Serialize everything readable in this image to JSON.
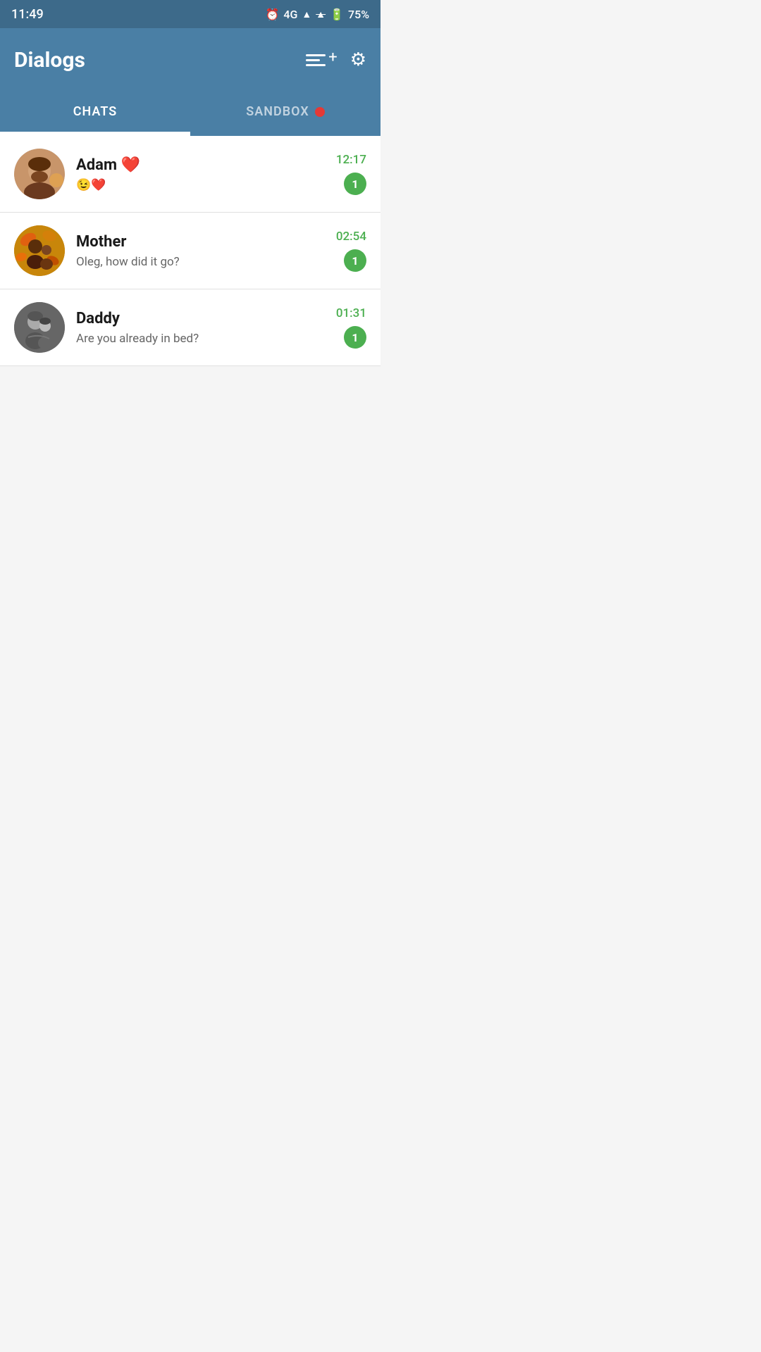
{
  "statusBar": {
    "time": "11:49",
    "signal": "4G",
    "battery": "75%"
  },
  "header": {
    "title": "Dialogs",
    "composeIcon": "compose-icon",
    "settingsIcon": "gear-icon"
  },
  "tabs": [
    {
      "id": "chats",
      "label": "CHATS",
      "active": true,
      "badge": false
    },
    {
      "id": "sandbox",
      "label": "SANDBOX",
      "active": false,
      "badge": true
    }
  ],
  "chats": [
    {
      "id": "adam",
      "name": "Adam ❤️",
      "preview": "😉❤️",
      "time": "12:17",
      "unread": 1,
      "avatarType": "adam"
    },
    {
      "id": "mother",
      "name": "Mother",
      "preview": "Oleg, how did it go?",
      "time": "02:54",
      "unread": 1,
      "avatarType": "mother"
    },
    {
      "id": "daddy",
      "name": "Daddy",
      "preview": "Are you already in bed?",
      "time": "01:31",
      "unread": 1,
      "avatarType": "daddy"
    }
  ]
}
